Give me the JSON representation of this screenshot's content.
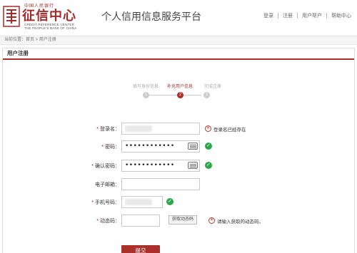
{
  "header": {
    "logo_top": "中国人民银行",
    "logo_main": "征信中心",
    "logo_en_line1": "CREDIT REFERENCE CENTER",
    "logo_en_line2": "THE PEOPLE'S BANK OF CHINA",
    "platform_title": "个人信用信息服务平台",
    "nav": [
      "登录",
      "注册",
      "用户帮户",
      "帮助中心"
    ]
  },
  "breadcrumb": "当前位置：首页 > 用户注册",
  "panel_title": "用户注册",
  "steps": [
    {
      "label": "填写身份信息",
      "number": "1",
      "active": false
    },
    {
      "label": "补充用户信息",
      "number": "2",
      "active": true
    },
    {
      "label": "完成注册",
      "number": "3",
      "active": false
    }
  ],
  "form": {
    "login_name": {
      "label": "登录名",
      "required": true,
      "error": "登录名已经存在"
    },
    "password": {
      "label": "密码",
      "required": true,
      "value": "••••••••••••"
    },
    "confirm_password": {
      "label": "确认密码",
      "required": true,
      "value": "••••••••••••"
    },
    "email": {
      "label": "电子邮箱",
      "required": false,
      "value": ""
    },
    "phone": {
      "label": "手机号码",
      "required": true
    },
    "sms_code": {
      "label": "动态码",
      "required": true,
      "button": "获取动态码",
      "error": "请输入获取的动态码。"
    }
  },
  "submit_label": "提交",
  "colors": {
    "brand": "#a9302b",
    "ok": "#2aa84a",
    "error": "#c0392b"
  },
  "icons": {
    "ok": "check-circle-icon",
    "error": "x-circle-icon",
    "keyboard": "keyboard-icon"
  }
}
